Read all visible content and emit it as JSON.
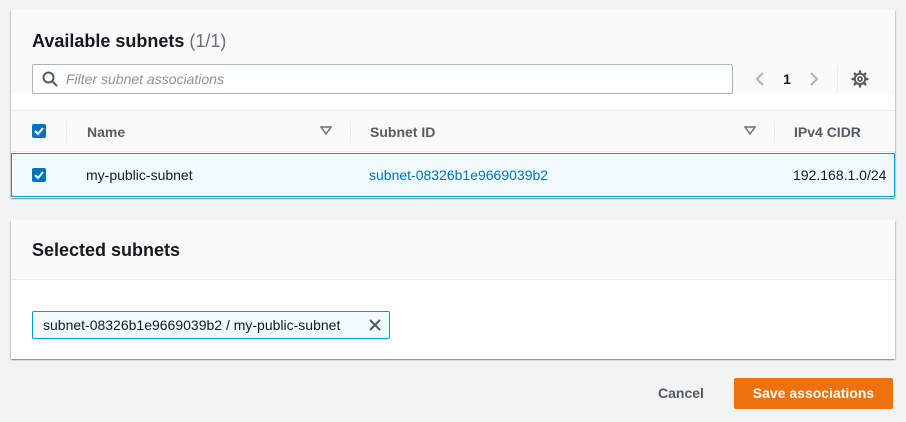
{
  "available": {
    "title": "Available subnets",
    "count": "(1/1)",
    "filter_placeholder": "Filter subnet associations",
    "page_number": "1",
    "columns": {
      "name": "Name",
      "subnet_id": "Subnet ID",
      "ipv4_cidr": "IPv4 CIDR"
    },
    "rows": [
      {
        "selected": true,
        "name": "my-public-subnet",
        "subnet_id": "subnet-08326b1e9669039b2",
        "ipv4_cidr": "192.168.1.0/24"
      }
    ]
  },
  "selected": {
    "title": "Selected subnets",
    "tokens": [
      {
        "label": "subnet-08326b1e9669039b2 / my-public-subnet"
      }
    ]
  },
  "footer": {
    "cancel_label": "Cancel",
    "save_label": "Save associations"
  },
  "colors": {
    "accent": "#0073bb",
    "primary_button": "#ec7211",
    "selection_border": "#00a1c9",
    "selection_bg": "#f1faff"
  },
  "icons": {
    "search": "search-icon",
    "prev": "chevron-left-icon",
    "next": "chevron-right-icon",
    "settings": "gear-icon",
    "sort": "caret-down-icon",
    "remove": "close-icon",
    "checkbox": "checkbox-checked-icon"
  }
}
